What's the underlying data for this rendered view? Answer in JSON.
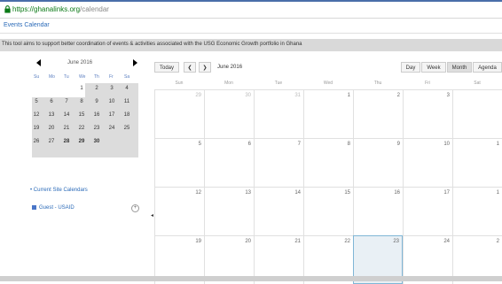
{
  "browser": {
    "url_host": "https://ghanalinks.org",
    "url_path": "/calendar"
  },
  "page": {
    "title": "Events Calendar",
    "banner": "This tool aims to support better coordination of events & activities associated with the USG Economic Growth portfolio in Ghana"
  },
  "mini_calendar": {
    "title": "June 2016",
    "prev_icon": "triangle-left-icon",
    "next_icon": "triangle-right-icon",
    "days_of_week": [
      "Su",
      "Mo",
      "Tu",
      "We",
      "Th",
      "Fr",
      "Sa"
    ],
    "weeks": [
      [
        "",
        "",
        "",
        "1",
        "2",
        "3",
        "4"
      ],
      [
        "5",
        "6",
        "7",
        "8",
        "9",
        "10",
        "11"
      ],
      [
        "12",
        "13",
        "14",
        "15",
        "16",
        "17",
        "18"
      ],
      [
        "19",
        "20",
        "21",
        "22",
        "23",
        "24",
        "25"
      ],
      [
        "26",
        "27",
        "28",
        "29",
        "30",
        "",
        ""
      ]
    ]
  },
  "sidebar": {
    "site_calendars_label": "• Current Site Calendars",
    "guest_calendar": "Guest - USAID",
    "guest_color": "#4a76c8",
    "add_icon": "plus-circle-icon",
    "collapse_icon": "chevron-left-icon"
  },
  "toolbar": {
    "today": "Today",
    "prev": "❮",
    "next": "❯",
    "month_label": "June 2016",
    "views": [
      "Day",
      "Week",
      "Month",
      "Agenda"
    ],
    "active_view": "Month"
  },
  "main_calendar": {
    "headers": [
      "Sun",
      "Mon",
      "Tue",
      "Wed",
      "Thu",
      "Fri",
      "Sat"
    ],
    "weeks": [
      [
        "29",
        "30",
        "31",
        "1",
        "2",
        "3",
        ""
      ],
      [
        "5",
        "6",
        "7",
        "8",
        "9",
        "10",
        "1"
      ],
      [
        "12",
        "13",
        "14",
        "15",
        "16",
        "17",
        "1"
      ],
      [
        "19",
        "20",
        "21",
        "22",
        "23",
        "24",
        "2"
      ]
    ],
    "muted_cells": [
      [
        0,
        0
      ],
      [
        0,
        1
      ],
      [
        0,
        2
      ]
    ],
    "today_cell": [
      3,
      4
    ],
    "today_color": "#7fb6d6"
  }
}
